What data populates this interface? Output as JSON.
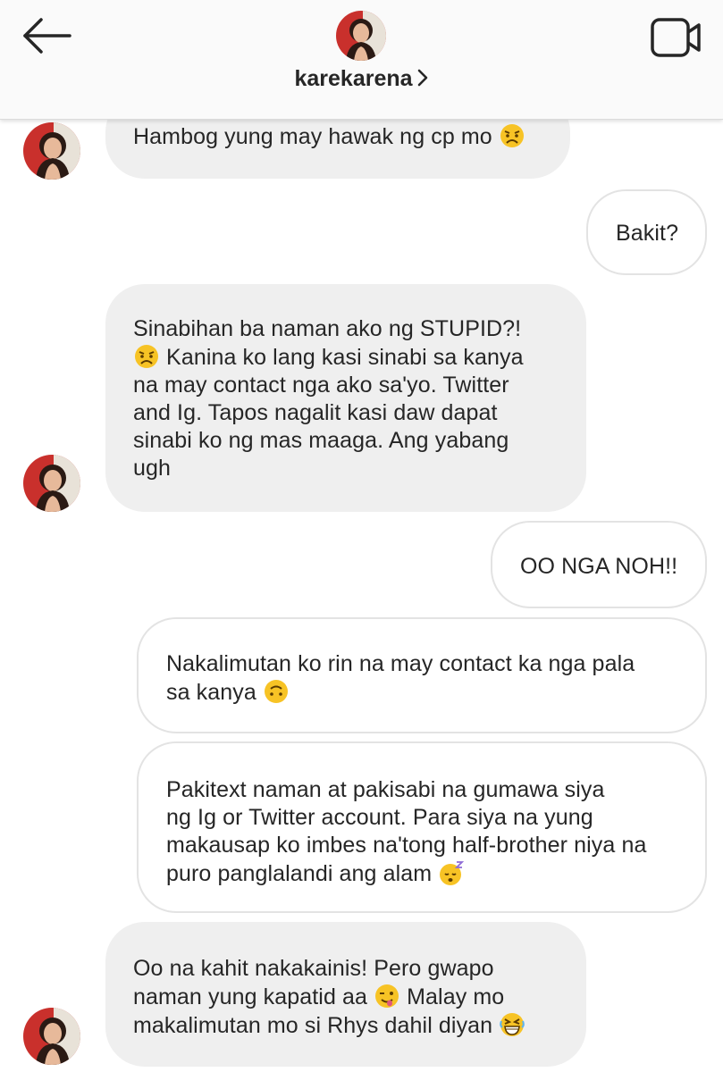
{
  "header": {
    "username": "karekarena",
    "back_icon": "arrow-left-icon",
    "video_icon": "video-call-icon"
  },
  "messages": [
    {
      "side": "in",
      "text": "Hambog yung may hawak ng cp mo",
      "emoji": "angry-face"
    },
    {
      "side": "out",
      "text": "Bakit?"
    },
    {
      "side": "in",
      "lines": [
        "Sinabihan ba naman ako ng STUPID?!",
        "Kanina ko lang kasi sinabi sa kanya",
        "na may contact nga ako sa'yo. Twitter",
        "and Ig. Tapos nagalit kasi daw dapat",
        "sinabi ko ng mas maaga. Ang yabang",
        "ugh"
      ],
      "emoji": "angry-face"
    },
    {
      "side": "out",
      "text": "OO NGA NOH!!"
    },
    {
      "side": "out",
      "lines": [
        "Nakalimutan ko rin na may contact ka nga pala",
        "sa kanya"
      ],
      "emoji": "upside-down-face"
    },
    {
      "side": "out",
      "lines": [
        "Pakitext naman at pakisabi na gumawa siya",
        "ng Ig or Twitter account. Para siya na yung",
        "makausap ko imbes na'tong half-brother niya na",
        "puro panglalandi ang alam"
      ],
      "emoji": "sleeping-face"
    },
    {
      "side": "in",
      "lines": [
        "Oo na kahit nakakainis! Pero gwapo",
        "naman yung kapatid aa",
        "makalimutan mo si Rhys dahil diyan"
      ],
      "inline_tail": "Malay mo",
      "emojis": [
        "winking-tongue-face",
        "grinning-squint-face"
      ]
    }
  ],
  "colors": {
    "incoming_bubble": "#efefef",
    "outgoing_border": "#e3e3e3",
    "header_bg": "#fafafa",
    "text": "#262626"
  }
}
